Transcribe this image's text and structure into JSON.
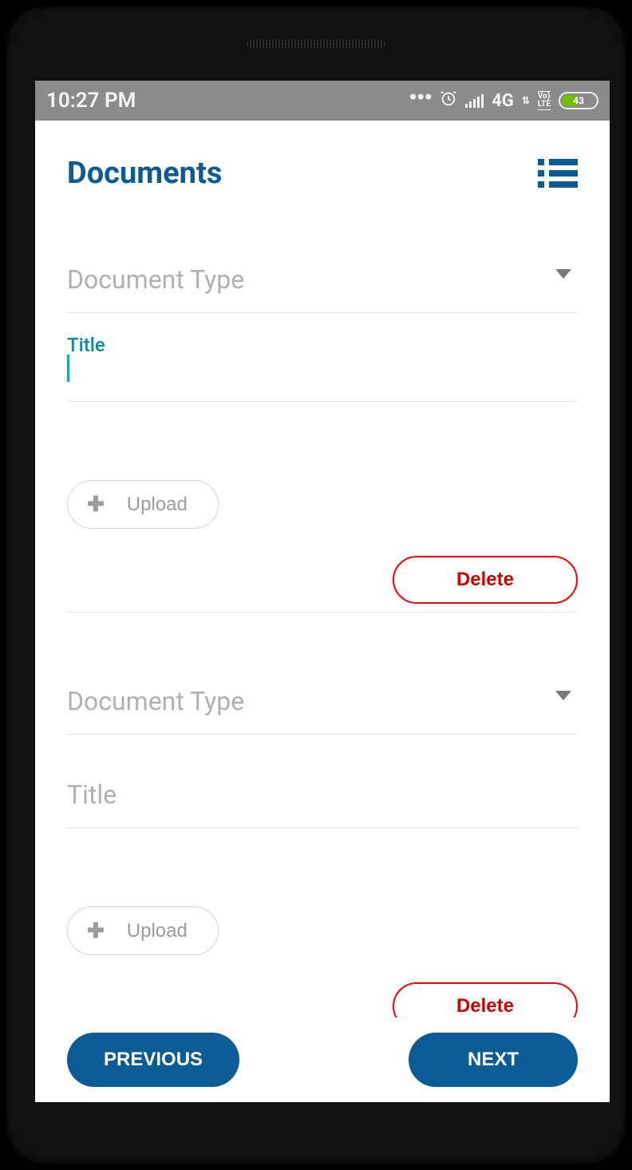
{
  "status": {
    "time": "10:27 PM",
    "network": "4G",
    "volte": "Vo\nLTE",
    "battery": "43"
  },
  "header": {
    "title": "Documents"
  },
  "blocks": [
    {
      "doc_type_label": "Document Type",
      "title_label": "Title",
      "title_value": "",
      "title_active": true
    },
    {
      "doc_type_label": "Document Type",
      "title_label": "Title",
      "title_value": "",
      "title_active": false
    }
  ],
  "buttons": {
    "upload": "Upload",
    "delete": "Delete",
    "previous": "PREVIOUS",
    "next": "NEXT"
  }
}
